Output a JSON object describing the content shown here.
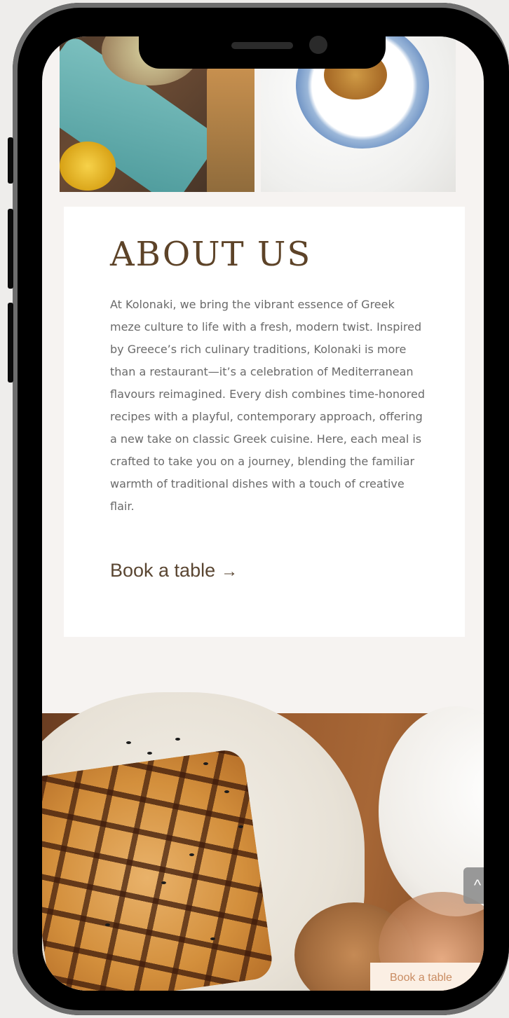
{
  "about": {
    "title": "ABOUT US",
    "text": "At Kolonaki, we bring the vibrant essence of Greek meze culture to life with a fresh, modern twist. Inspired by Greece’s rich culinary traditions, Kolonaki is more than a restaurant—it’s a celebration of Mediterranean flavours reimagined. Every dish combines time-honored recipes with a playful, contemporary approach, offering a new take on classic Greek cuisine. Here, each meal is crafted to take you on a journey, blending the familiar warmth of traditional dishes with a touch of creative flair.",
    "link_label": "Book a table",
    "link_arrow": "→"
  },
  "sticky": {
    "book_label": "Book a table"
  },
  "scroll_top": {
    "icon": "chevron-up-icon",
    "glyph": "^"
  },
  "colors": {
    "title": "#5d4328",
    "body_text": "#6a6a6a",
    "page_bg": "#f6f3f1",
    "sticky_bg": "#fbefe4",
    "sticky_text": "#c98c62"
  }
}
